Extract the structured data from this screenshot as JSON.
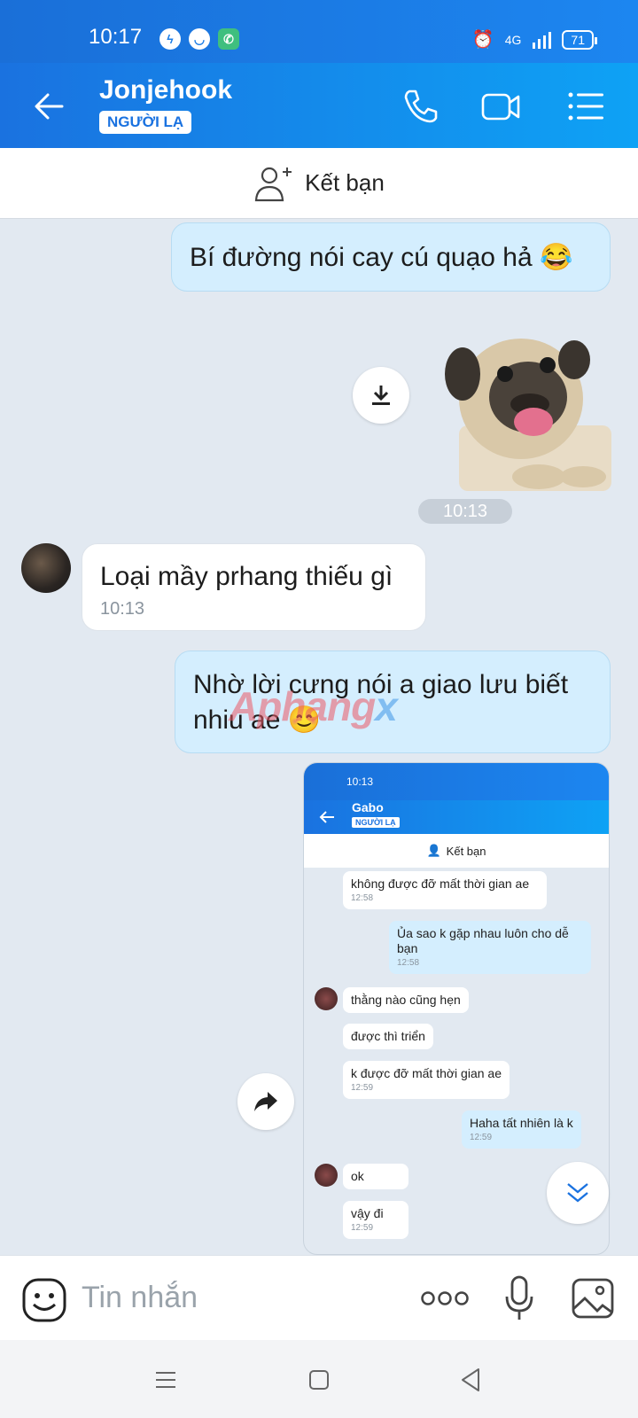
{
  "status_bar": {
    "time": "10:17",
    "network": "4G",
    "battery": "71",
    "notification_icons": [
      "messenger-icon",
      "bubble-icon",
      "phone-app-icon"
    ]
  },
  "header": {
    "contact_name": "Jonjehook",
    "badge": "NGƯỜI LẠ"
  },
  "friend_bar": {
    "label": "Kết bạn"
  },
  "messages": {
    "m1_text": "Bí đường nói cay cú quạo hả 😂",
    "sticker_time": "10:13",
    "m2_text": "Loại mầy prhang thiếu gì",
    "m2_time": "10:13",
    "m3_text": "Nhờ lời cưng nói a giao lưu biết nhiu ae 😊"
  },
  "watermark": {
    "part1": "Aphang",
    "part2": "x"
  },
  "embedded": {
    "time": "10:13",
    "contact_name": "Gabo",
    "badge": "NGƯỜI LẠ",
    "friend_label": "Kết bạn",
    "msgs": [
      {
        "text": "không được đỡ mất thời gian ae",
        "time": "12:58"
      },
      {
        "text": "Ủa sao k gặp nhau luôn cho dễ bạn",
        "time": "12:58"
      },
      {
        "text": "thằng nào cũng hẹn"
      },
      {
        "text": "được thì triển"
      },
      {
        "text": "k được đỡ mất thời gian ae",
        "time": "12:59"
      },
      {
        "text": "Haha tất nhiên là k",
        "time": "12:59"
      },
      {
        "text": "ok"
      },
      {
        "text": "vậy đi",
        "time": "12:59"
      }
    ]
  },
  "input": {
    "placeholder": "Tin nhắn"
  },
  "colors": {
    "header_blue": "#1a72e0",
    "out_bubble": "#d4eefe",
    "in_bubble": "#ffffff",
    "chat_bg": "#e2e9f1"
  }
}
